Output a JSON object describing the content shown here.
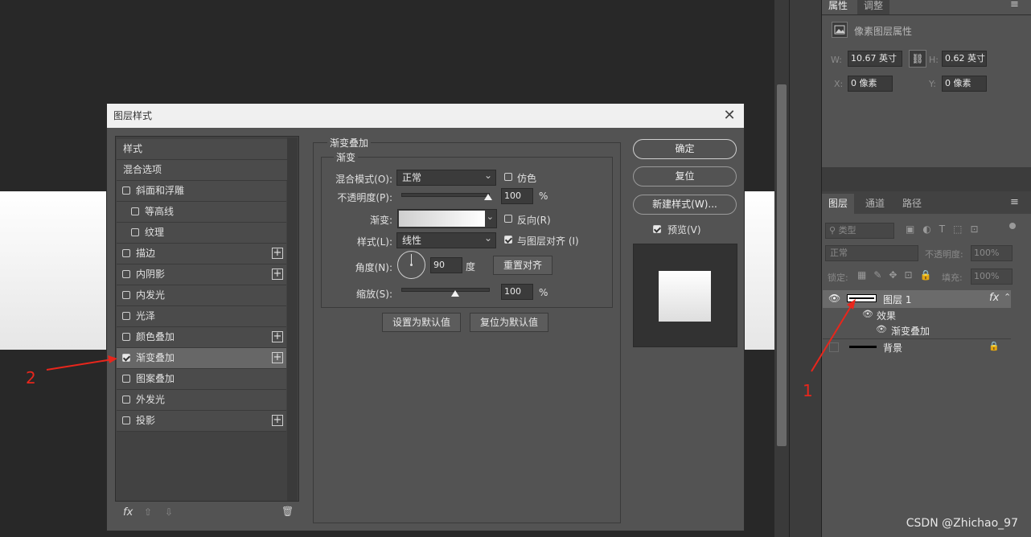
{
  "right_panel": {
    "tabs": [
      "属性",
      "调整"
    ],
    "section_title": "像素图层属性",
    "w_label": "W:",
    "w_value": "10.67 英寸",
    "h_label": "H:",
    "h_value": "0.62 英寸",
    "x_label": "X:",
    "x_value": "0 像素",
    "y_label": "Y:",
    "y_value": "0 像素",
    "layers_tabs": [
      "图层",
      "通道",
      "路径"
    ],
    "search_placeholder": "类型",
    "blend_mode": "正常",
    "opacity_label": "不透明度:",
    "opacity_value": "100%",
    "lock_label": "锁定:",
    "fill_label": "填充:",
    "fill_value": "100%",
    "layers": [
      {
        "name": "图层 1",
        "fx": "fx"
      },
      {
        "name": "效果"
      },
      {
        "name": "渐变叠加"
      },
      {
        "name": "背景"
      }
    ]
  },
  "dialog": {
    "title": "图层样式",
    "style_list": [
      {
        "label": "样式",
        "checkbox": false,
        "plus": false
      },
      {
        "label": "混合选项",
        "checkbox": false,
        "plus": false
      },
      {
        "label": "斜面和浮雕",
        "checkbox": true,
        "checked": false,
        "plus": false
      },
      {
        "label": "等高线",
        "checkbox": true,
        "checked": false,
        "plus": false,
        "indent": true
      },
      {
        "label": "纹理",
        "checkbox": true,
        "checked": false,
        "plus": false,
        "indent": true
      },
      {
        "label": "描边",
        "checkbox": true,
        "checked": false,
        "plus": true
      },
      {
        "label": "内阴影",
        "checkbox": true,
        "checked": false,
        "plus": true
      },
      {
        "label": "内发光",
        "checkbox": true,
        "checked": false,
        "plus": false
      },
      {
        "label": "光泽",
        "checkbox": true,
        "checked": false,
        "plus": false
      },
      {
        "label": "颜色叠加",
        "checkbox": true,
        "checked": false,
        "plus": true
      },
      {
        "label": "渐变叠加",
        "checkbox": true,
        "checked": true,
        "plus": true,
        "selected": true
      },
      {
        "label": "图案叠加",
        "checkbox": true,
        "checked": false,
        "plus": false
      },
      {
        "label": "外发光",
        "checkbox": true,
        "checked": false,
        "plus": false
      },
      {
        "label": "投影",
        "checkbox": true,
        "checked": false,
        "plus": true
      }
    ],
    "fx_label": "fx",
    "section_title": "渐变叠加",
    "group_title": "渐变",
    "blend_mode_label": "混合模式(O):",
    "blend_mode_value": "正常",
    "dither_label": "仿色",
    "opacity_label": "不透明度(P):",
    "opacity_value": "100",
    "percent": "%",
    "gradient_label": "渐变:",
    "reverse_label": "反向(R)",
    "style_label": "样式(L):",
    "style_value": "线性",
    "align_label": "与图层对齐 (I)",
    "angle_label": "角度(N):",
    "angle_value": "90",
    "angle_unit": "度",
    "reset_align_button": "重置对齐",
    "scale_label": "缩放(S):",
    "scale_value": "100",
    "make_default_button": "设置为默认值",
    "reset_default_button": "复位为默认值",
    "ok_button": "确定",
    "reset_button": "复位",
    "new_style_button": "新建样式(W)...",
    "preview_label": "预览(V)"
  },
  "annotations": {
    "one": "1",
    "two": "2"
  },
  "watermark": "CSDN @Zhichao_97"
}
